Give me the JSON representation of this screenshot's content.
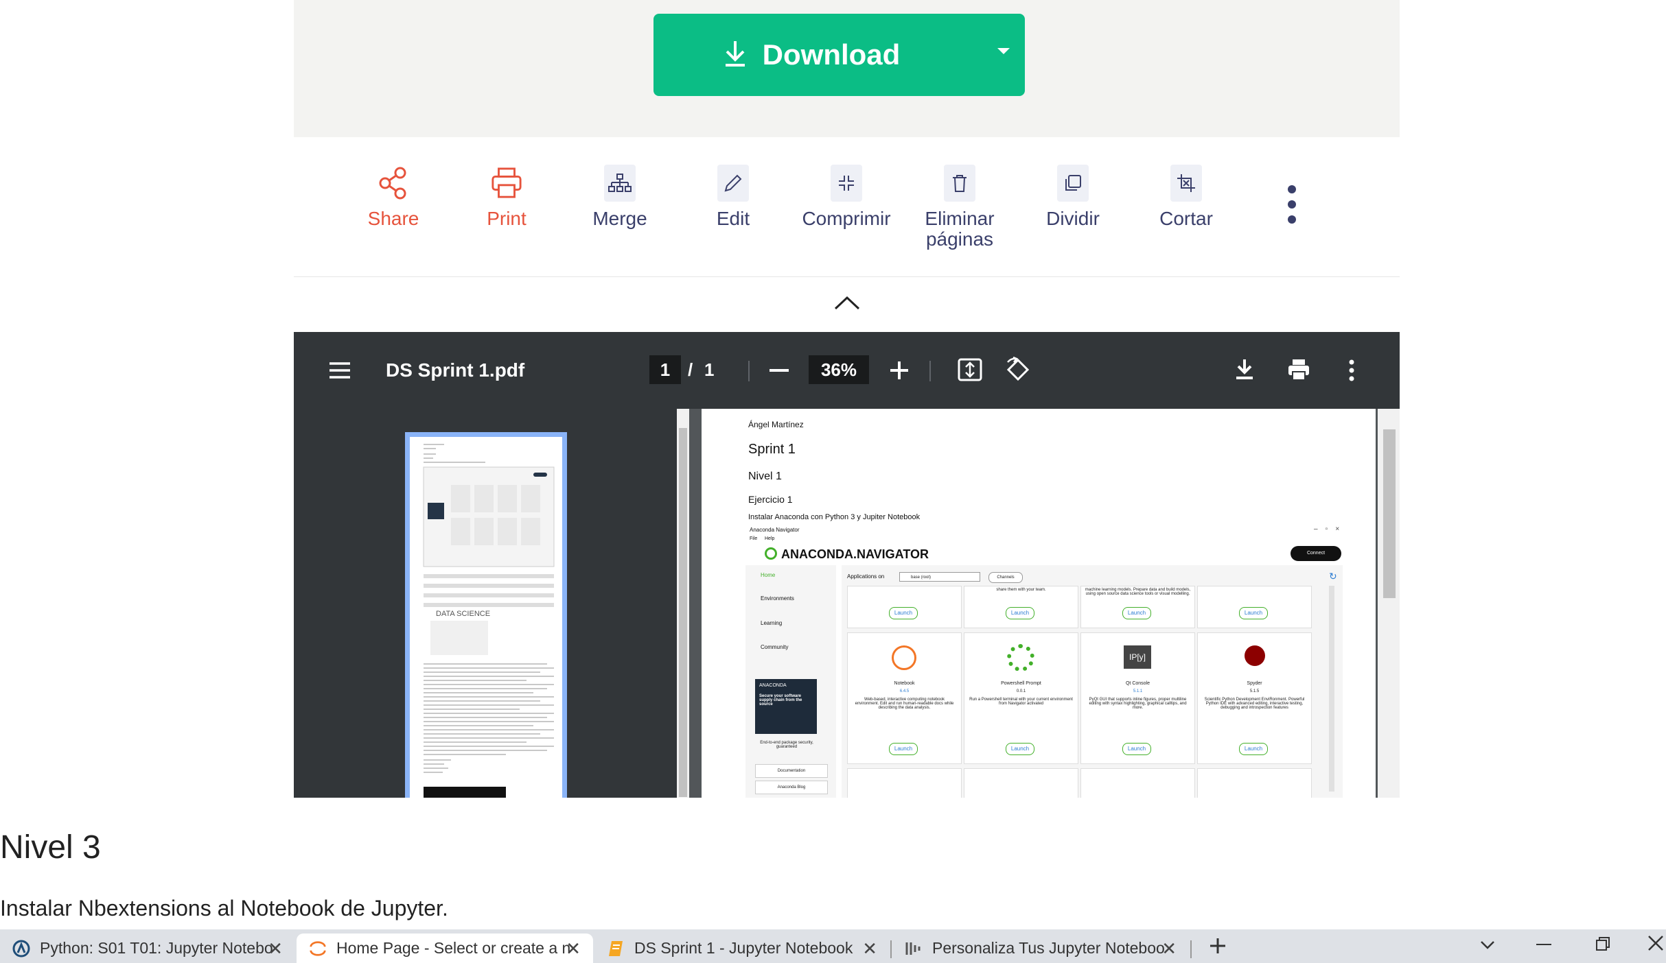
{
  "download": {
    "label": "Download"
  },
  "toolbar": {
    "items": [
      {
        "label": "Share"
      },
      {
        "label": "Print"
      },
      {
        "label": "Merge"
      },
      {
        "label": "Edit"
      },
      {
        "label": "Comprimir"
      },
      {
        "label": "Eliminar páginas"
      },
      {
        "label": "Dividir"
      },
      {
        "label": "Cortar"
      }
    ]
  },
  "pdf_viewer": {
    "file_name": "DS Sprint 1.pdf",
    "page_current": "1",
    "page_sep": "/",
    "page_total": "1",
    "zoom": "36%"
  },
  "document": {
    "author": "Ángel Martínez",
    "title": "Sprint 1",
    "level": "Nivel 1",
    "exercise": "Ejercicio 1",
    "instruction": "Instalar Anaconda con Python 3 y Jupiter Notebook",
    "anaconda": {
      "window_title": "Anaconda Navigator",
      "menu": [
        "File",
        "Help"
      ],
      "brand": "ANACONDA.NAVIGATOR",
      "connect": "Connect",
      "nav": [
        "Home",
        "Environments",
        "Learning",
        "Community"
      ],
      "apps_on": "Applications on",
      "env": "base (root)",
      "channels": "Channels",
      "top_cards": [
        {
          "text": ""
        },
        {
          "text": "share them with your team."
        },
        {
          "text": "machine learning models. Prepare data and build models, using open source data science tools or visual modelling."
        },
        {
          "text": ""
        }
      ],
      "apps": [
        {
          "name": "Notebook",
          "version": "6.4.5",
          "desc": "Web-based, interactive computing notebook environment. Edit and run human-readable docs while describing the data analysis."
        },
        {
          "name": "Powershell Prompt",
          "version": "0.0.1",
          "desc": "Run a Powershell terminal with your current environment from Navigator activated"
        },
        {
          "name": "Qt Console",
          "version": "5.1.1",
          "desc": "PyQt GUI that supports inline figures, proper multiline editing with syntax highlighting, graphical calltips, and more."
        },
        {
          "name": "Spyder",
          "version": "5.1.5",
          "desc": "Scientific Python Development EnviRonment. Powerful Python IDE with advanced editing, interactive testing, debugging and introspection features"
        }
      ],
      "launch": "Launch",
      "promo": {
        "brand": "ANACONDA",
        "text": "Secure your software supply chain from the source",
        "sub": "End-to-end package security, guaranteed"
      },
      "documentation": "Documentation",
      "anaconda_blog": "Anaconda Blog"
    },
    "thumb_banner": "DATA SCIENCE"
  },
  "page": {
    "heading": "Nivel 3",
    "text": "Instalar Nbextensions al Notebook de Jupyter."
  },
  "tabs": [
    {
      "title": "Python: S01 T01: Jupyter Notebo",
      "icon": "anaconda-icon"
    },
    {
      "title": "Home Page - Select or create a n",
      "icon": "jupyter-icon"
    },
    {
      "title": "DS Sprint 1 - Jupyter Notebook",
      "icon": "notebook-icon"
    },
    {
      "title": "Personaliza Tus Jupyter Noteboo",
      "icon": "bars-icon"
    }
  ],
  "colors": {
    "download_green": "#0bbd85",
    "share_red": "#e6533c",
    "pdf_toolbar": "#323639",
    "thumb_border": "#8ab4f8"
  }
}
